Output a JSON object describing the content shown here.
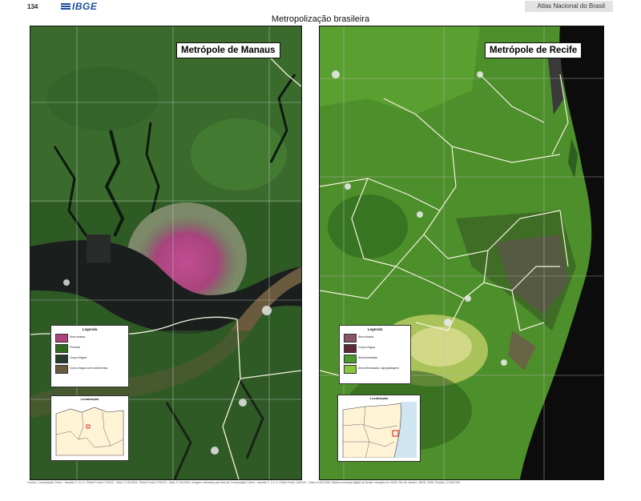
{
  "header": {
    "page_number": "134",
    "logo_text": "IBGE",
    "atlas_title": "Atlas Nacional do Brasil"
  },
  "title": "Metropolização brasileira",
  "maps": {
    "manaus": {
      "label": "Metrópole de Manaus",
      "legend": {
        "title": "Legenda",
        "items": [
          {
            "label": "Área urbana",
            "color": "#b0417f"
          },
          {
            "label": "Floresta",
            "color": "#2f6a1f"
          },
          {
            "label": "Corpo d'água",
            "color": "#283a2a"
          },
          {
            "label": "Corpo d'água com sedimentos",
            "color": "#6a5a3e"
          }
        ]
      },
      "locator": {
        "title": "Localização"
      }
    },
    "recife": {
      "label": "Metrópole de Recife",
      "legend": {
        "title": "Legenda",
        "items": [
          {
            "label": "Área urbana",
            "color": "#8a5468"
          },
          {
            "label": "Corpo d'água",
            "color": "#5b2a33"
          },
          {
            "label": "Área florestada",
            "color": "#4d9a2c"
          },
          {
            "label": "Área desmatada / agropastagem",
            "color": "#8cc63a"
          }
        ]
      },
      "locator": {
        "title": "Localização"
      }
    }
  },
  "source_note": "Fontes: Composição Cbers - bandas 2, 3 e 4. Órbita Ponto 173/103 - Data 17.08.2004. Órbita Ponto 175/103 - Data 17.08.2004. Imagem utilizada para fins de Composição Cbers - bandas 2, 3 e 4. Órbita Ponto 145/109 - Data 19.08.2005. Malha municipal digital do Brasil: situação em 2005. Rio de Janeiro: IBGE, 2006. Escala 1:2 500 000."
}
